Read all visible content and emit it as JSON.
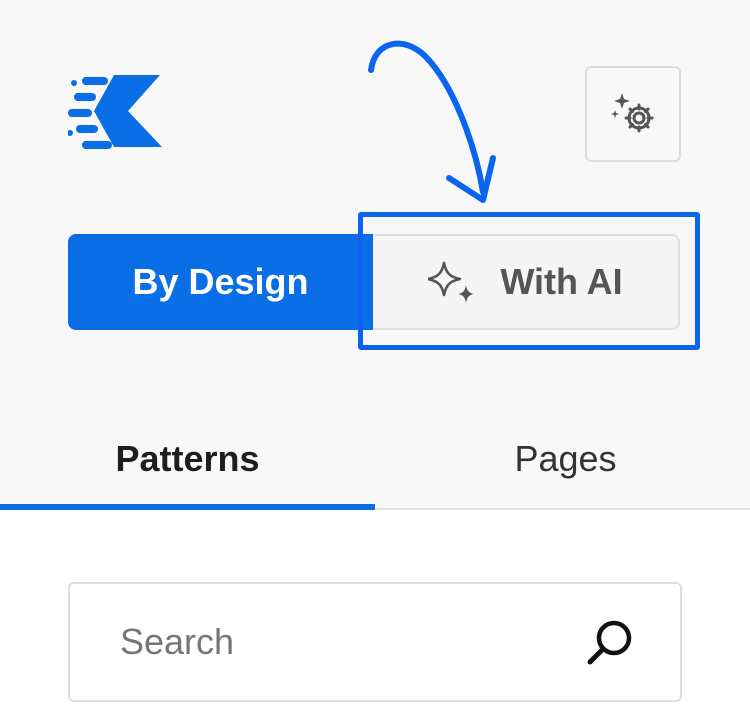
{
  "header": {
    "logo_icon": "speed-k-logo-icon",
    "settings_icon": "sparkle-gear-icon"
  },
  "mode_toggle": {
    "by_design_label": "By Design",
    "with_ai_label": "With AI",
    "with_ai_icon": "sparkles-icon",
    "selected": "By Design"
  },
  "tabs": [
    {
      "label": "Patterns",
      "active": true
    },
    {
      "label": "Pages",
      "active": false
    }
  ],
  "search": {
    "placeholder": "Search",
    "value": "",
    "icon": "search-icon"
  },
  "colors": {
    "accent": "#0a6fe6",
    "annotation": "#0a64f0",
    "background": "#f8f8f8"
  }
}
